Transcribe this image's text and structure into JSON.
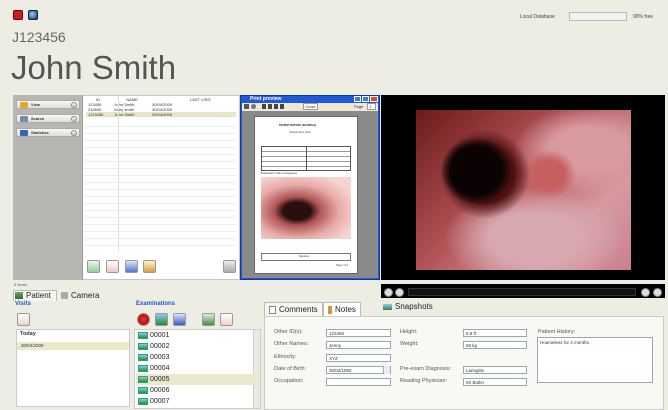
{
  "header": {
    "patient_id": "J123456",
    "patient_name": "John Smith",
    "db_label": "Local Database",
    "db_free": "90% free"
  },
  "nav": {
    "items": [
      {
        "label": "View"
      },
      {
        "label": "Search"
      },
      {
        "label": "Statistics"
      }
    ]
  },
  "patient_table": {
    "columns": [
      "ID",
      "NAME",
      "LAST VISIT"
    ],
    "rows": [
      [
        "123456",
        "John Smith",
        "30/04/2009"
      ],
      [
        "234605",
        "Mary smith",
        "30/04/2009"
      ],
      [
        "J123456",
        "John Smith",
        "30/04/2009"
      ]
    ]
  },
  "status": {
    "items": "3 Items"
  },
  "print_preview": {
    "title": "Print preview",
    "close_label": "Close",
    "page_label": "Page",
    "page_value": "1",
    "report_title": "PATIENT REPORT (EXAMPLE)",
    "report_sub": "Hospital Voice Clinic",
    "diag_text": "Examination: Video Laryngoscopy",
    "footer_name": "Signature:",
    "footer_page": "Page 1 of 1"
  },
  "video": {
    "time": "00:"
  },
  "left_tabs": {
    "patient": "Patient",
    "camera": "Camera"
  },
  "visits": {
    "title": "Visits",
    "today_label": "Today",
    "items": [
      "30/04/2009"
    ]
  },
  "examinations": {
    "title": "Examinations",
    "items": [
      "00001",
      "00002",
      "00003",
      "00004",
      "00005",
      "00006",
      "00007"
    ]
  },
  "detail_tabs": {
    "comments": "Comments",
    "notes": "Notes",
    "snapshots": "Snapshots"
  },
  "form": {
    "other_ids_label": "Other ID(s):",
    "other_ids_value": "123456",
    "other_names_label": "Other Names:",
    "other_names_value": "Jenny",
    "ethnicity_label": "Ethnicity:",
    "ethnicity_value": "XYZ",
    "dob_label": "Date of Birth:",
    "dob_value": "30/04/1950",
    "occupation_label": "Occupation:",
    "occupation_value": "",
    "height_label": "Height:",
    "height_value": "5.9 ft",
    "weight_label": "Weight:",
    "weight_value": "69 kg",
    "preexam_label": "Pre-exam Diagnosis:",
    "preexam_value": "Laringitis",
    "physician_label": "Reading Physician:",
    "physician_value": "Mr Butler",
    "history_label": "Patient History:",
    "history_value": "Hoarseless for 4 months."
  },
  "colors": {
    "bg": "#eeede4",
    "video_bg": "#000000",
    "accent_blue": "#1f56c8"
  }
}
